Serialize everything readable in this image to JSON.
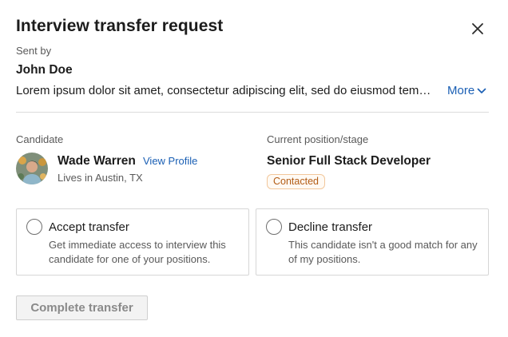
{
  "modal": {
    "title": "Interview transfer request",
    "close_icon": "close-icon"
  },
  "sender": {
    "label": "Sent by",
    "name": "John Doe",
    "message": "Lorem ipsum dolor sit amet, consectetur adipiscing elit, sed do eiusmod tempor incididunt ut labore et dolore magna aliqua.",
    "more_label": "More",
    "more_icon": "chevron-down-icon"
  },
  "candidate": {
    "label": "Candidate",
    "name": "Wade Warren",
    "view_profile_label": "View Profile",
    "location": "Lives in Austin, TX",
    "avatar_icon": "avatar"
  },
  "position": {
    "label": "Current position/stage",
    "title": "Senior Full Stack Developer",
    "stage": "Contacted"
  },
  "options": [
    {
      "title": "Accept transfer",
      "description": "Get immediate access to interview this candidate for one of your positions."
    },
    {
      "title": "Decline transfer",
      "description": "This candidate isn't a good match for any of my positions."
    }
  ],
  "actions": {
    "complete_label": "Complete transfer"
  },
  "colors": {
    "link": "#1a5fb4",
    "badge_text": "#b25b14",
    "badge_border": "#f2c79b",
    "muted_text": "#595959"
  }
}
